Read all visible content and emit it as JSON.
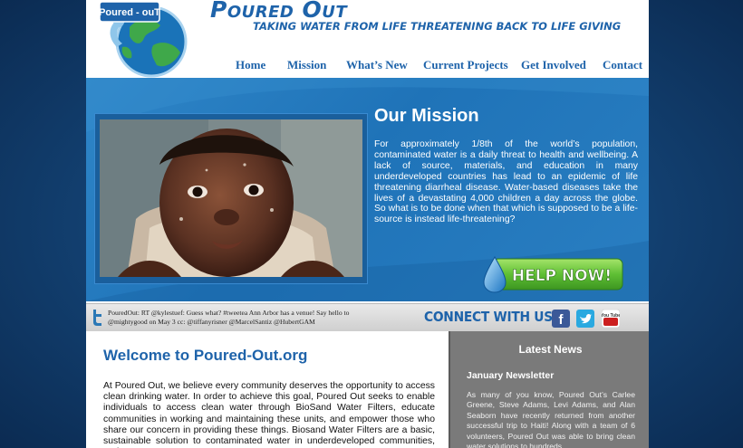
{
  "brand": {
    "logo_text": "Poured - ouT",
    "site_title": "Poured Out",
    "tagline": "TAKING WATER FROM LIFE THREATENING BACK TO LIFE GIVING"
  },
  "nav": {
    "items": [
      {
        "label": "Home"
      },
      {
        "label": "Mission"
      },
      {
        "label": "What’s New"
      },
      {
        "label": "Current Projects"
      },
      {
        "label": "Get Involved"
      },
      {
        "label": "Contact"
      }
    ]
  },
  "hero": {
    "title": "Our Mission",
    "text": "For approximately 1/8th of the world’s population, contaminated water is a daily threat to health and wellbeing. A lack of source, materials, and education in many underdeveloped countries has lead to an epidemic of life threatening diarrheal disease. Water-based diseases take the lives of a devastating 4,000 children a day across the globe. So what is to be done when that which is supposed to be a life-source is instead life-threatening?",
    "help_button": "HELP NOW!"
  },
  "connect": {
    "tweet": "PouredOut: RT @kylestuef: Guess what? #tweetea Ann Arbor has a venue! Say hello to @mightygood on May 3 cc: @tiffanyrisner @MarcelSantiz @HubertGAM",
    "label": "CONNECT WITH US:",
    "social": [
      {
        "name": "facebook",
        "glyph": "f",
        "color": "#3b5998"
      },
      {
        "name": "twitter",
        "glyph": "t",
        "color": "#2aa9e0"
      },
      {
        "name": "youtube",
        "glyph": "You Tube",
        "color": "#cc1f1f"
      }
    ]
  },
  "welcome": {
    "title": "Welcome to Poured-Out.org",
    "text": "At Poured Out, we believe every community deserves the opportunity to access clean drinking water. In order to achieve this goal, Poured Out seeks to enable individuals to access clean water through BioSand Water Filters, educate communities in working and maintaining these units, and empower those who share our concern in providing these things. Biosand Water Filters are a basic, sustainable solution to contaminated water in underdeveloped communities, and"
  },
  "news": {
    "title": "Latest News",
    "item_title": "January Newsletter",
    "item_text": "As many of you know, Poured Out’s Carlee Greene, Steve Adams, Levi Adams, and Alan Seaborn have recently returned from another successful trip to Haiti! Along with a team of 6 volunteers, Poured Out was able to bring clean water solutions to hundreds"
  }
}
